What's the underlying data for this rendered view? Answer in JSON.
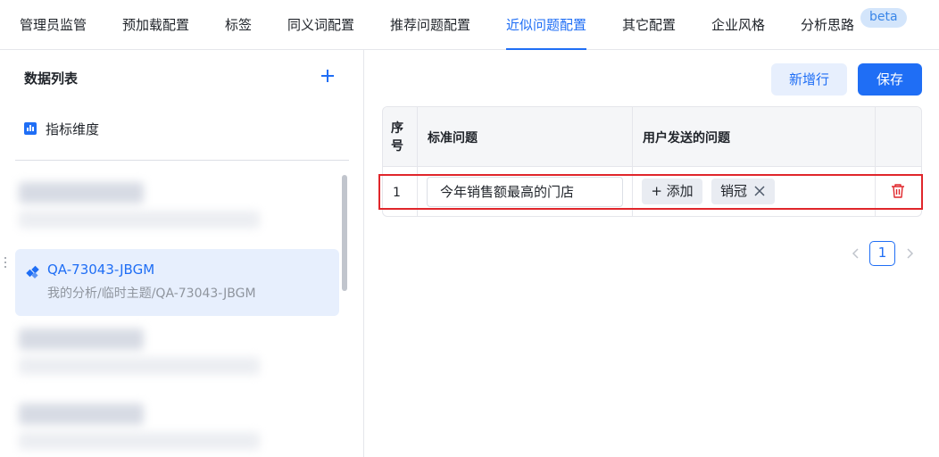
{
  "tabs": [
    {
      "label": "管理员监管"
    },
    {
      "label": "预加载配置"
    },
    {
      "label": "标签"
    },
    {
      "label": "同义词配置"
    },
    {
      "label": "推荐问题配置"
    },
    {
      "label": "近似问题配置",
      "active": true
    },
    {
      "label": "其它配置"
    },
    {
      "label": "企业风格"
    },
    {
      "label": "分析思路"
    }
  ],
  "beta_badge": "beta",
  "sidebar": {
    "title": "数据列表",
    "dimension_label": "指标维度",
    "selected_item": {
      "title": "QA-73043-JBGM",
      "path": "我的分析/临时主题/QA-73043-JBGM",
      "icon": "diamond-icon"
    }
  },
  "toolbar": {
    "add_row_label": "新增行",
    "save_label": "保存"
  },
  "table": {
    "headers": {
      "index": "序号",
      "standard_question": "标准问题",
      "user_questions": "用户发送的问题"
    },
    "rows": [
      {
        "index": "1",
        "standard_question": "今年销售额最高的门店",
        "add_label": "+ 添加",
        "tags": [
          "销冠"
        ]
      }
    ]
  },
  "pagination": {
    "current_page": "1"
  },
  "colors": {
    "accent": "#1f6ef5",
    "danger": "#e0262b"
  }
}
